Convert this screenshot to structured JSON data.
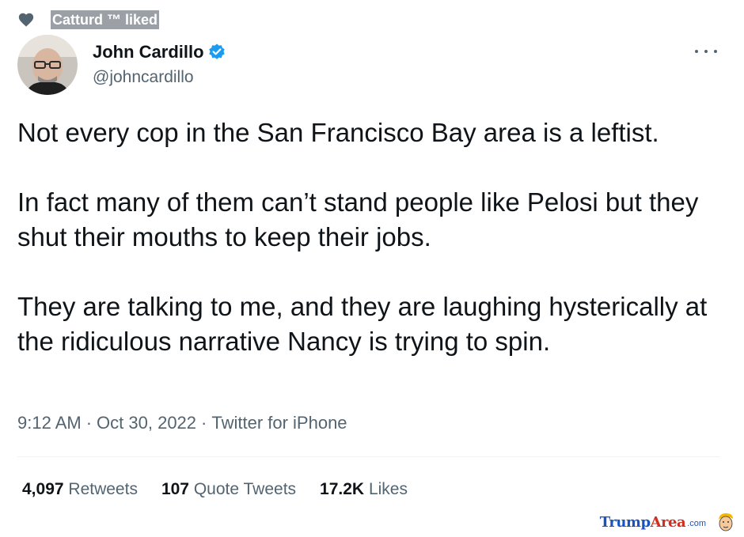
{
  "social_context": {
    "label": "Catturd ™ liked",
    "icon": "heart-icon"
  },
  "author": {
    "display_name": "John Cardillo",
    "handle": "@johncardillo",
    "verified": true,
    "verified_color": "#1d9bf0"
  },
  "tweet": {
    "paragraphs": [
      "Not every cop in the San Francisco Bay area is a leftist.",
      "In fact many of them can’t stand people like Pelosi but they shut their mouths to keep their jobs.",
      "They are talking to me, and they are laughing hysterically at the ridiculous narrative Nancy is trying to spin."
    ],
    "time": "9:12 AM",
    "date": "Oct 30, 2022",
    "source": "Twitter for iPhone",
    "separator": "·"
  },
  "stats": {
    "retweets": {
      "count": "4,097",
      "label": "Retweets"
    },
    "quotes": {
      "count": "107",
      "label": "Quote Tweets"
    },
    "likes": {
      "count": "17.2K",
      "label": "Likes"
    }
  },
  "watermark": {
    "trump": "Trump",
    "area": "Area",
    "com": ".com"
  },
  "colors": {
    "text_primary": "#0f1419",
    "text_secondary": "#536471",
    "verified": "#1d9bf0",
    "divider": "#eff3f4"
  }
}
